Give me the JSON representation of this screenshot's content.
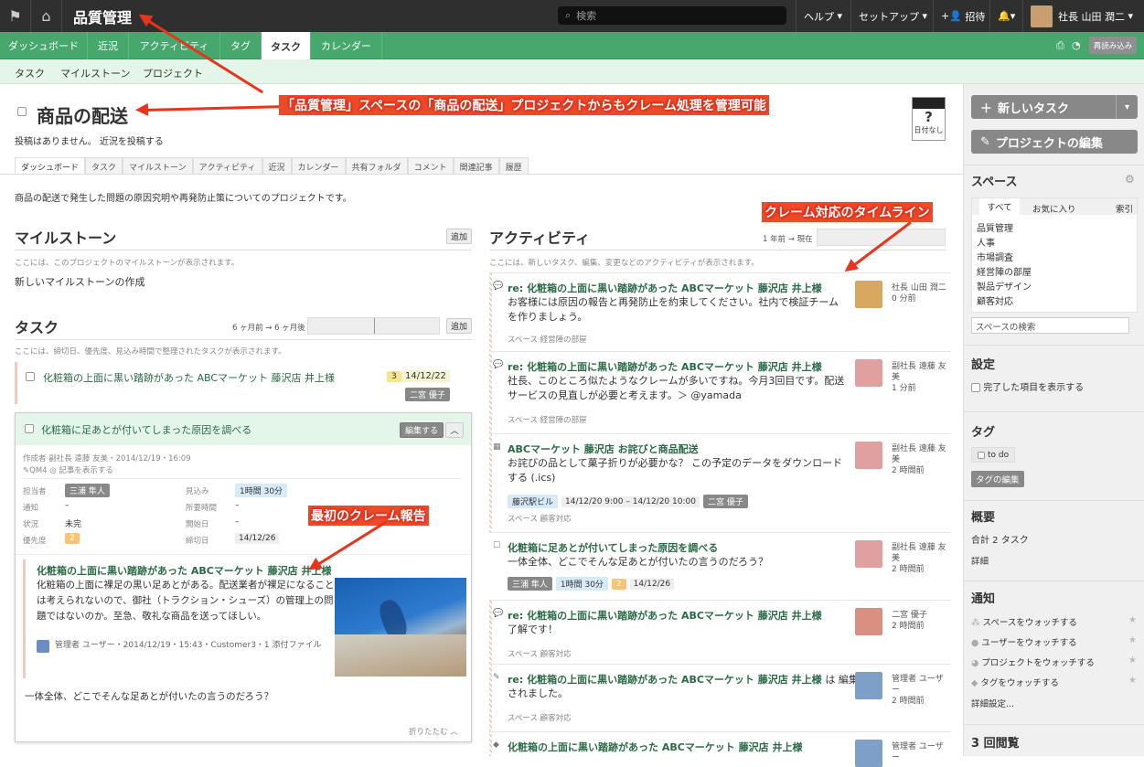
{
  "topbar": {
    "flag_icon": "flag-icon",
    "home_icon": "home-icon",
    "space_title": "品質管理",
    "search_placeholder": "検索",
    "help": "ヘルプ",
    "setup": "セットアップ",
    "invite": "招待",
    "notifications_icon": "bell-icon",
    "user_name": "社長 山田 潤二"
  },
  "main_tabs": [
    "ダッシュボード",
    "近況",
    "アクティビティ",
    "タグ",
    "タスク",
    "カレンダー"
  ],
  "active_main_tab": "タスク",
  "reload": "再読み込み",
  "sub_tabs": [
    "タスク",
    "マイルストーン",
    "プロジェクト"
  ],
  "annotations": {
    "project_note": "「品質管理」スペースの「商品の配送」プロジェクトからもクレーム処理を管理可能",
    "timeline_note": "クレーム対応のタイムライン",
    "first_report_note": "最初のクレーム報告"
  },
  "project": {
    "title": "商品の配送",
    "no_posts": "投稿はありません。",
    "post_status": "近況を投稿する",
    "date_box_top": "?",
    "date_box_bottom": "日付なし",
    "tabs": [
      "ダッシュボード",
      "タスク",
      "マイルストーン",
      "アクティビティ",
      "近況",
      "カレンダー",
      "共有フォルダ",
      "コメント",
      "関連記事",
      "履歴"
    ],
    "description": "商品の配送で発生した問題の原因究明や再発防止策についてのプロジェクトです。"
  },
  "milestones": {
    "heading": "マイルストーン",
    "add": "追加",
    "hint": "ここには、このプロジェクトのマイルストーンが表示されます。",
    "create": "新しいマイルストーンの作成"
  },
  "tasks": {
    "heading": "タスク",
    "range": "6 ヶ月前 → 6 ヶ月後",
    "add": "追加",
    "hint": "ここには、締切日、優先度、見込み時間で整理されたタスクが表示されます。",
    "task1": {
      "title": "化粧箱の上面に黒い踏跡があった ABCマーケット 藤沢店 井上様",
      "priority": "3",
      "date": "14/12/22",
      "assignee": "二宮 優子"
    },
    "task2": {
      "title": "化粧箱に足あとが付いてしまった原因を調べる",
      "edit": "編集する",
      "created": "作成者 副社長 遠藤 友美・2014/12/19・16:09",
      "tag": "QM4",
      "show_article": "記事を表示する",
      "labels": {
        "assignee": "担当者",
        "estimate": "見込み",
        "notify": "通知",
        "time_spent": "所要時間",
        "status": "状況",
        "start": "開始日",
        "priority": "優先度",
        "due": "締切日"
      },
      "values": {
        "assignee": "三浦 隼人",
        "estimate": "1時間 30分",
        "notify": "–",
        "time_spent": "–",
        "status": "未完",
        "start": "–",
        "priority": "2",
        "due": "14/12/26"
      },
      "article_title": "化粧箱の上面に黒い踏跡があった ABCマーケット 藤沢店 井上様",
      "article_body": "化粧箱の上面に裸足の黒い足あとがある。配送業者が裸足になることは考えられないので、御社（トラクション・シューズ）の管理上の問題ではないのか。至急、敬礼な商品を送ってほしい。",
      "article_meta": "管理者 ユーザー・2014/12/19・15:43・Customer3・1 添付ファイル",
      "question": "一体全体、どこでそんな足あとが付いたの言うのだろう？",
      "collapse": "折りたたむ"
    }
  },
  "activity": {
    "heading": "アクティビティ",
    "range": "1 年前 → 現在",
    "hint": "ここには、新しいタスク、編集、変更などのアクティビティが表示されます。",
    "items": [
      {
        "title": "re: 化粧箱の上面に黒い踏跡があった ABCマーケット 藤沢店 井上様",
        "body": "お客様には原因の報告と再発防止を約束してください。社内で検証チームを作りましょう。",
        "meta": "スペース 経営陣の部屋",
        "who": "社長 山田 潤二",
        "when": "0 分前"
      },
      {
        "title": "re: 化粧箱の上面に黒い踏跡があった ABCマーケット 藤沢店 井上様",
        "body": "社長、このところ似たようなクレームが多いですね。今月3回目です。配送サービスの見直しが必要と考えます。＞ @yamada",
        "meta": "スペース 経営陣の部屋",
        "who": "副社長 遠藤 友美",
        "when": "1 分前"
      },
      {
        "title": "ABCマーケット 藤沢店 お詫びと商品配送",
        "body": "お詫びの品として菓子折りが必要かな？ この予定のデータをダウンロードする (.ics)",
        "place": "藤沢駅ビル",
        "time": "14/12/20 9:00 – 14/12/20 10:00",
        "assignee": "二宮 優子",
        "meta": "スペース 顧客対応",
        "who": "副社長 遠藤 友美",
        "when": "2 時間前"
      },
      {
        "title": "化粧箱に足あとが付いてしまった原因を調べる",
        "body": "一体全体、どこでそんな足あとが付いたの言うのだろう？",
        "assignee": "三浦 隼人",
        "estimate": "1時間 30分",
        "priority": "2",
        "date": "14/12/26",
        "who": "副社長 遠藤 友美",
        "when": "2 時間前"
      },
      {
        "title": "re: 化粧箱の上面に黒い踏跡があった ABCマーケット 藤沢店 井上様",
        "body": "了解です！",
        "meta": "スペース 顧客対応",
        "who": "二宮 優子",
        "when": "2 時間前"
      },
      {
        "title": "re: 化粧箱の上面に黒い踏跡があった ABCマーケット 藤沢店 井上様",
        "title_suffix": "は 編集",
        "body": "されました。",
        "meta": "スペース 顧客対応",
        "who": "管理者 ユーザー",
        "when": "2 時間前"
      },
      {
        "title": "化粧箱の上面に黒い踏跡があった ABCマーケット 藤沢店 井上様",
        "who": "管理者 ユーザー"
      }
    ]
  },
  "sidebar": {
    "new_task": "新しいタスク",
    "edit_project": "プロジェクトの編集",
    "spaces_heading": "スペース",
    "space_tabs": [
      "すべて",
      "お気に入り",
      "索引"
    ],
    "spaces": [
      "品質管理",
      "人事",
      "市場調査",
      "経営陣の部屋",
      "製品デザイン",
      "顧客対応"
    ],
    "space_search": "スペースの検索",
    "settings_heading": "設定",
    "show_completed": "完了した項目を表示する",
    "tags_heading": "タグ",
    "tag": "to do",
    "edit_tags": "タグの編集",
    "summary_heading": "概要",
    "summary_total": "合計 2 タスク",
    "details": "詳細",
    "notify_heading": "通知",
    "watch": [
      "スペースをウォッチする",
      "ユーザーをウォッチする",
      "プロジェクトをウォッチする",
      "タグをウォッチする"
    ],
    "advanced": "詳細設定...",
    "views": "3 回閲覧"
  },
  "colors": {
    "green": "#46a86c",
    "accent_red": "#e8341c",
    "link_green": "#2a6b46"
  }
}
